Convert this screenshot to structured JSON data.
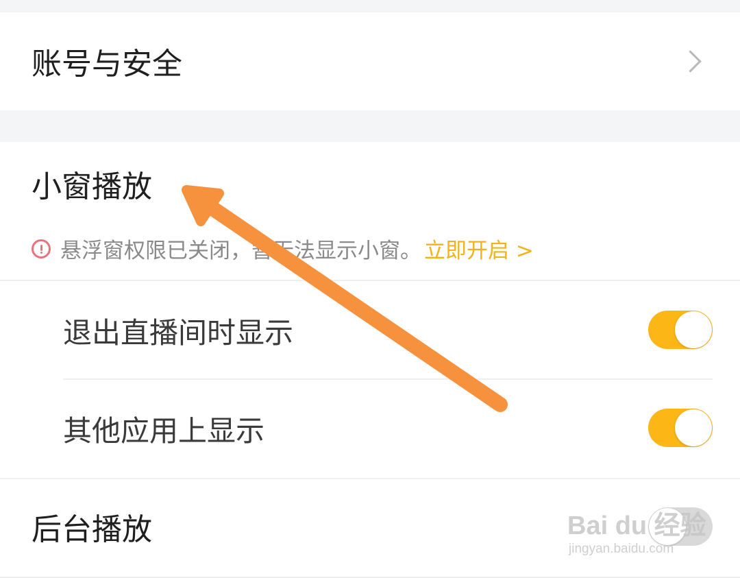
{
  "account_row": {
    "title": "账号与安全",
    "chevron_icon": "chevron-right-icon"
  },
  "mini_window": {
    "title": "小窗播放",
    "notice": {
      "icon": "warning-circle-icon",
      "text": "悬浮窗权限已关闭，暂无法显示小窗。",
      "link": "立即开启 >"
    },
    "options": [
      {
        "label": "退出直播间时显示",
        "enabled": true
      },
      {
        "label": "其他应用上显示",
        "enabled": true
      }
    ]
  },
  "background_play": {
    "title": "后台播放",
    "enabled": false
  },
  "watermark": {
    "main": "Bai du 经验",
    "sub": "jingyan.baidu.com"
  },
  "colors": {
    "accent": "#fcb616",
    "link": "#f2b21a",
    "warning": "#e8737a",
    "annotation_arrow": "#f6923e"
  }
}
